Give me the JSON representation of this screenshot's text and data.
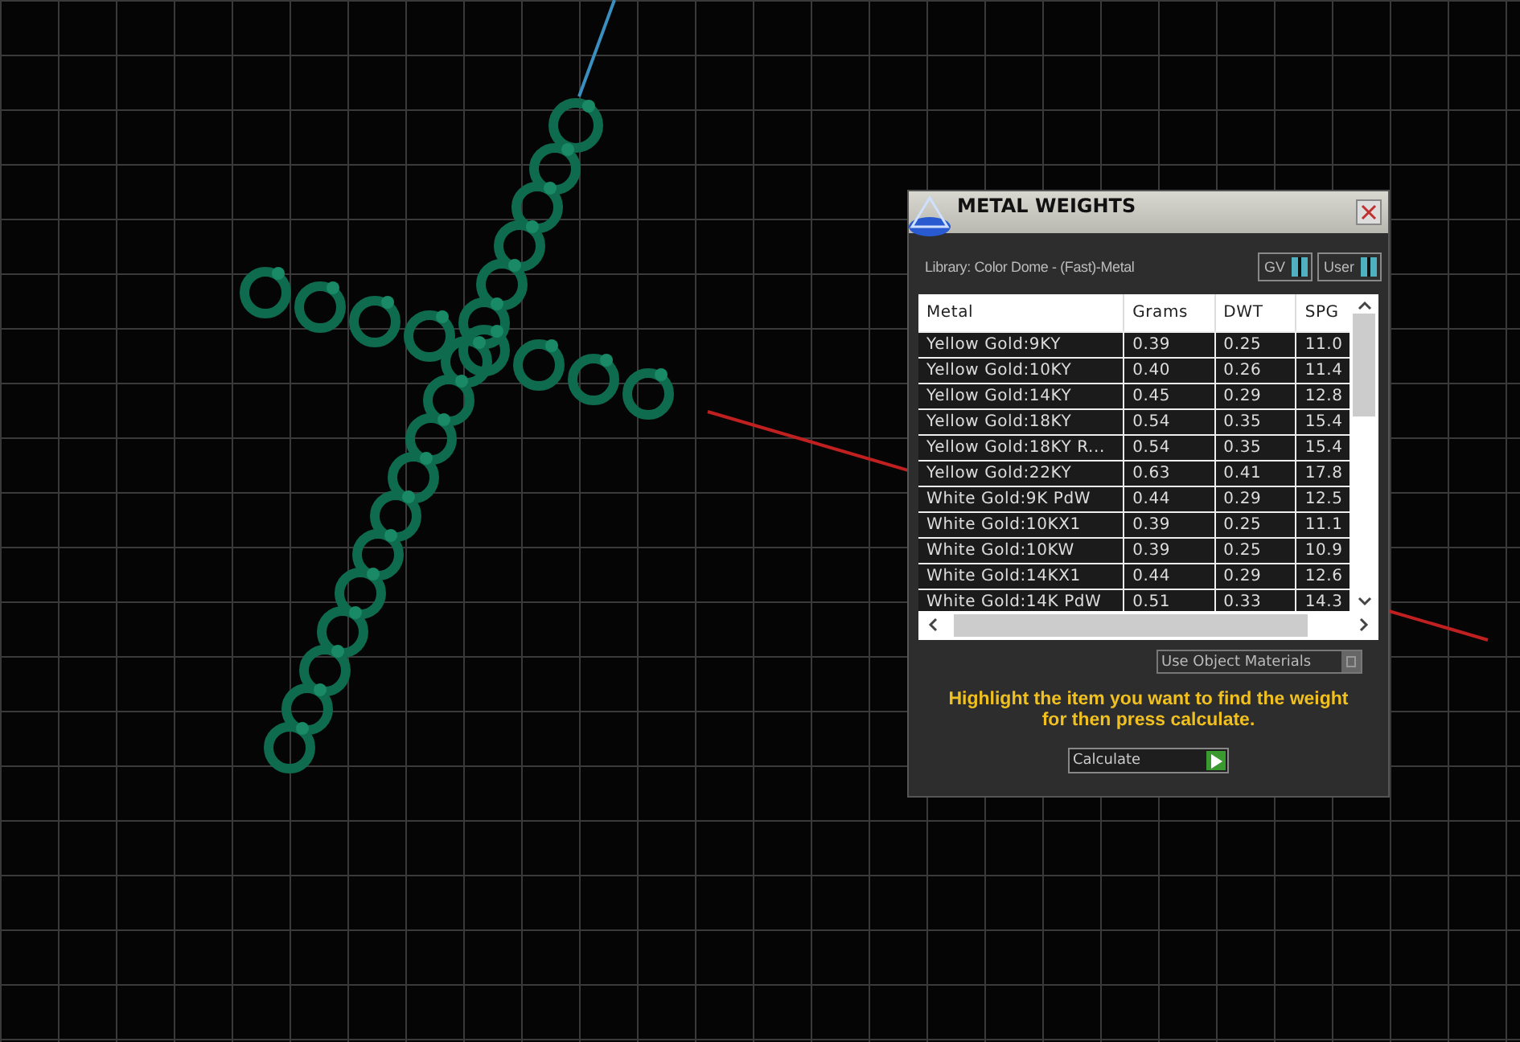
{
  "dialog": {
    "title": "METAL WEIGHTS",
    "library": "Library: Color Dome - (Fast)-Metal",
    "toggles": [
      {
        "label": "GV",
        "on": true
      },
      {
        "label": "User",
        "on": true
      }
    ],
    "table": {
      "columns": [
        "Metal",
        "Grams",
        "DWT",
        "SPG"
      ],
      "rows": [
        {
          "cells": [
            "Yellow Gold:9KY",
            "0.39",
            "0.25",
            "11.0"
          ]
        },
        {
          "cells": [
            "Yellow Gold:10KY",
            "0.40",
            "0.26",
            "11.4"
          ]
        },
        {
          "cells": [
            "Yellow Gold:14KY",
            "0.45",
            "0.29",
            "12.8"
          ]
        },
        {
          "cells": [
            "Yellow Gold:18KY",
            "0.54",
            "0.35",
            "15.4"
          ]
        },
        {
          "cells": [
            "Yellow Gold:18KY R...",
            "0.54",
            "0.35",
            "15.4"
          ]
        },
        {
          "cells": [
            "Yellow Gold:22KY",
            "0.63",
            "0.41",
            "17.8"
          ]
        },
        {
          "cells": [
            "White Gold:9K PdW",
            "0.44",
            "0.29",
            "12.5"
          ]
        },
        {
          "cells": [
            "White Gold:10KX1",
            "0.39",
            "0.25",
            "11.1"
          ]
        },
        {
          "cells": [
            "White Gold:10KW",
            "0.39",
            "0.25",
            "10.9"
          ]
        },
        {
          "cells": [
            "White Gold:14KX1",
            "0.44",
            "0.29",
            "12.6"
          ]
        },
        {
          "cells": [
            "White Gold:14K PdW",
            "0.51",
            "0.33",
            "14.3"
          ]
        }
      ]
    },
    "use_object_materials": {
      "label": "Use Object Materials",
      "checked": false
    },
    "hint": "Highlight the item you want to find the weight for then press calculate.",
    "calculate_button": "Calculate"
  }
}
